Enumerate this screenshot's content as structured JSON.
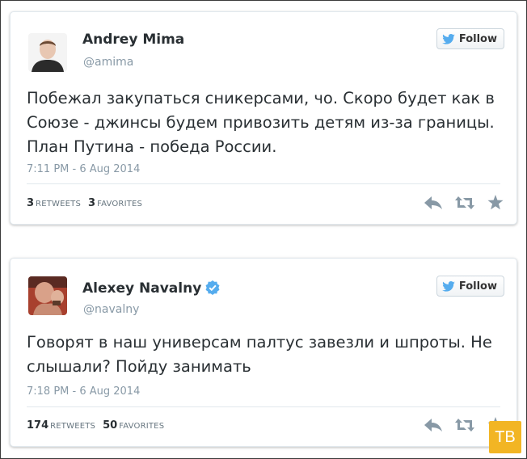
{
  "tweets": [
    {
      "name": "Andrey Mima",
      "handle": "@amima",
      "follow_label": "Follow",
      "text": "Побежал закупаться сникерсами, чо. Скоро будет как в Союзе - джинсы будем привозить детям из-за границы. План Путина - победа России.",
      "timestamp": "7:11 PM - 6 Aug 2014",
      "retweets": "3",
      "retweets_label": "RETWEETS",
      "favorites": "3",
      "favorites_label": "FAVORITES",
      "verified": false
    },
    {
      "name": "Alexey Navalny",
      "handle": "@navalny",
      "follow_label": "Follow",
      "text": "Говорят в наш универсам палтус завезли и шпроты. Не слышали? Пойду занимать",
      "timestamp": "7:18 PM - 6 Aug 2014",
      "retweets": "174",
      "retweets_label": "RETWEETS",
      "favorites": "50",
      "favorites_label": "FAVORITES",
      "verified": true
    }
  ],
  "watermark": {
    "text": "ТВ",
    "color": "#f2b524"
  },
  "colors": {
    "twitter_blue": "#55acee",
    "muted": "#8899a6",
    "text": "#292f33",
    "action_gray": "#8899a6"
  }
}
